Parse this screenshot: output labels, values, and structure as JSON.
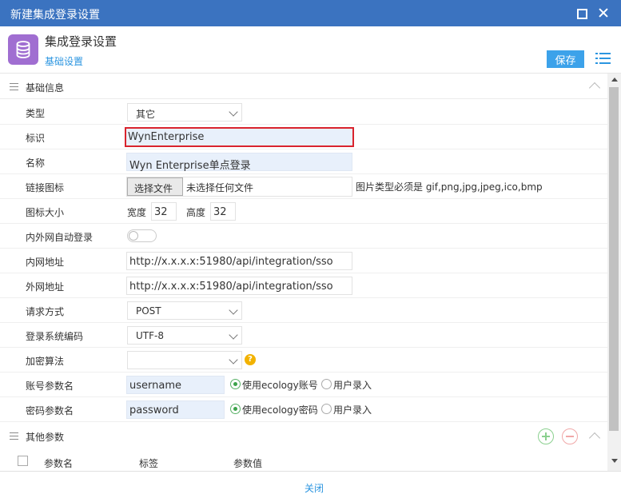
{
  "window": {
    "title": "新建集成登录设置"
  },
  "header": {
    "title": "集成登录设置",
    "tab": "基础设置",
    "save_label": "保存"
  },
  "sections": {
    "basic": "基础信息",
    "other": "其他参数"
  },
  "form": {
    "type": {
      "label": "类型",
      "value": "其它"
    },
    "ident": {
      "label": "标识",
      "value": "WynEnterprise"
    },
    "name": {
      "label": "名称",
      "value": "Wyn Enterprise单点登录"
    },
    "link_icon": {
      "label": "链接图标",
      "button": "选择文件",
      "no_file": "未选择任何文件",
      "hint": "图片类型必须是 gif,png,jpg,jpeg,ico,bmp"
    },
    "icon_size": {
      "label": "图标大小",
      "width_label": "宽度",
      "width": "32",
      "height_label": "高度",
      "height": "32"
    },
    "auto_login": {
      "label": "内外网自动登录",
      "on": false
    },
    "intranet": {
      "label": "内网地址",
      "value": "http://x.x.x.x:51980/api/integration/sso"
    },
    "extranet": {
      "label": "外网地址",
      "value": "http://x.x.x.x:51980/api/integration/sso"
    },
    "method": {
      "label": "请求方式",
      "value": "POST"
    },
    "encoding": {
      "label": "登录系统编码",
      "value": "UTF-8"
    },
    "encrypt": {
      "label": "加密算法",
      "value": ""
    },
    "account": {
      "label": "账号参数名",
      "value": "username",
      "opt1": "使用ecology账号",
      "opt2": "用户录入"
    },
    "password": {
      "label": "密码参数名",
      "value": "password",
      "opt1": "使用ecology密码",
      "opt2": "用户录入"
    }
  },
  "table": {
    "columns": [
      "参数名",
      "标签",
      "参数值"
    ]
  },
  "footer": {
    "close_label": "关闭"
  },
  "icons": {
    "app": "database-icon",
    "help": "question-icon"
  },
  "colors": {
    "titlebar": "#3b73c0",
    "accent": "#2b95e0",
    "app_icon": "#a06ed1",
    "highlight": "#d9232d"
  }
}
